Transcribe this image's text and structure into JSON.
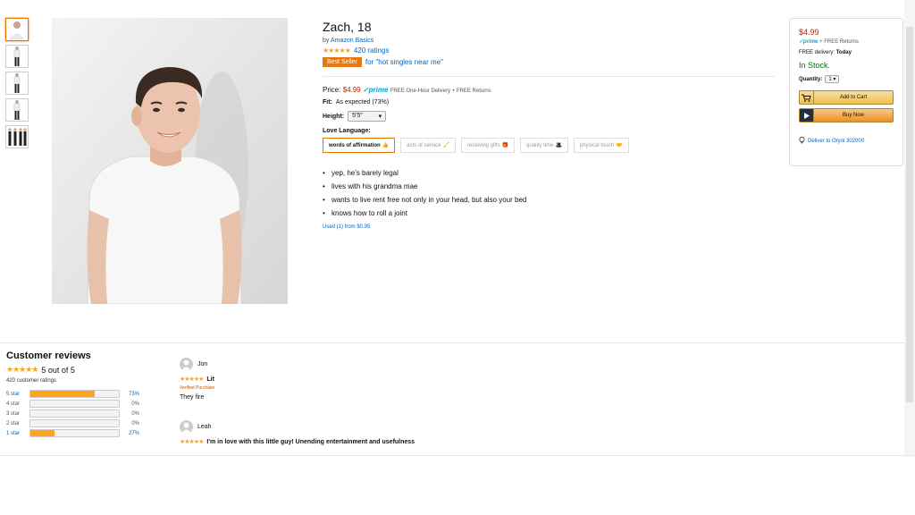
{
  "thumbnails": [
    "thumb-1",
    "thumb-2",
    "thumb-3",
    "thumb-4",
    "thumb-5"
  ],
  "product": {
    "title": "Zach, 18",
    "by_label": "by",
    "brand": "Amazon Basics",
    "stars": "★★★★★",
    "ratings_count": "420 ratings",
    "bestseller_badge": "Best Seller",
    "bestseller_for": "for \"hot singles near me\"",
    "price_label": "Price:",
    "price": "$4.99",
    "prime": "✓prime",
    "delivery_note": "FREE One-Hour Delivery + FREE Returns",
    "fit_label": "Fit:",
    "fit_value": "As expected (73%)",
    "height_label": "Height:",
    "height_value": "5'5\"",
    "love_label": "Love Language:",
    "love_options": [
      {
        "label": "words of affirmation",
        "icon": "👍"
      },
      {
        "label": "acts of service",
        "icon": "🧹"
      },
      {
        "label": "receiving gifts",
        "icon": "🎁"
      },
      {
        "label": "quality time",
        "icon": "🎩"
      },
      {
        "label": "physical touch",
        "icon": "🤝"
      }
    ],
    "bullets": [
      "yep, he's barely legal",
      "lives with his grandma mae",
      "wants to live rent free not only in your head, but also your bed",
      "knows how to roll a joint"
    ],
    "used_link": "Used (1) from $0.95"
  },
  "buybox": {
    "price": "$4.99",
    "prime": "✓prime",
    "returns": "+ FREE Returns",
    "delivery_label": "FREE delivery:",
    "delivery_value": "Today",
    "stock": "In Stock.",
    "qty_label": "Quantity:",
    "qty_value": "1",
    "add_to_cart": "Add to Cart",
    "buy_now": "Buy Now",
    "deliver_to": "Deliver to Oryol 302000"
  },
  "reviews": {
    "title": "Customer reviews",
    "stars": "★★★★★",
    "average": "5 out of 5",
    "count": "420 customer ratings",
    "histogram": [
      {
        "label": "5 star",
        "pct": "73%",
        "value": 0.73
      },
      {
        "label": "4 star",
        "pct": "0%",
        "value": 0
      },
      {
        "label": "3 star",
        "pct": "0%",
        "value": 0
      },
      {
        "label": "2 star",
        "pct": "0%",
        "value": 0
      },
      {
        "label": "1 star",
        "pct": "27%",
        "value": 0.27
      }
    ],
    "items": [
      {
        "user": "Jon",
        "stars": "★★★★★",
        "title": "Lit",
        "verified": "Verified Purchase",
        "body": "They fire"
      },
      {
        "user": "Leah",
        "stars": "★★★★★",
        "title": "I'm in love with this little guy! Unending entertainment and usefulness",
        "verified": "",
        "body": ""
      }
    ]
  },
  "colors": {
    "link": "#0066c0",
    "price": "#b12704",
    "star": "#f4a41d",
    "stock": "#007600",
    "badge": "#e47911"
  }
}
